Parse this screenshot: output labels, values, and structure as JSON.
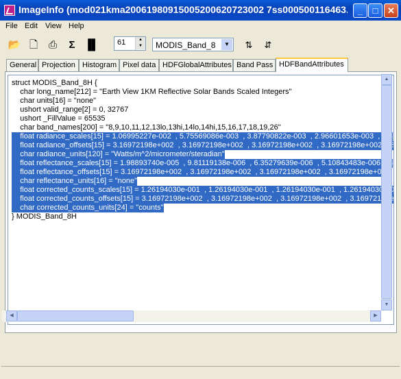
{
  "window": {
    "title": "ImageInfo (mod021kma20061980915005200620723002 7ss000500116463...",
    "buttons": {
      "minimize": "_",
      "maximize": "□",
      "close": "✕"
    }
  },
  "menu": [
    "File",
    "Edit",
    "View",
    "Help"
  ],
  "toolbar": {
    "icons": [
      "folder-open-icon",
      "new-file-icon",
      "print-icon",
      "sigma-icon",
      "histogram-icon",
      "sort-up-icon",
      "sort-down-icon"
    ],
    "band_number": "61",
    "band_select": "MODIS_Band_8"
  },
  "tabs": [
    "General",
    "Projection",
    "Histogram",
    "Pixel data",
    "HDFGlobalAttributes",
    "Band Pass",
    "HDFBandAttributes"
  ],
  "active_tab": "HDFBandAttributes",
  "content": {
    "lines": [
      "struct MODIS_Band_8H {",
      "    char long_name[212] = \"Earth View 1KM Reflective Solar Bands Scaled Integers\"",
      "    char units[16] = \"none\"",
      "    ushort valid_range[2] = 0, 32767",
      "    ushort _FillValue = 65535",
      "    char band_names[200] = \"8,9,10,11,12,13lo,13hi,14lo,14hi,15,16,17,18,19,26\"",
      "    float radiance_scales[15] = 1.06995227e-002  , 5.75569086e-003  , 3.87790822e-003  , 2.96601653e-003  , 2.5",
      "    float radiance_offsets[15] = 3.16972198e+002  , 3.16972198e+002  , 3.16972198e+002  , 3.16972198e+002  , 3",
      "    char radiance_units[120] = \"Watts/m^2/micrometer/steradian\"",
      "    float reflectance_scales[15] = 1.98893740e-005  , 9.81119138e-006  , 6.35279639e-006  , 5.10843483e-006  , 4",
      "    float reflectance_offsets[15] = 3.16972198e+002  , 3.16972198e+002  , 3.16972198e+002  , 3.16972198e+002",
      "    char reflectance_units[16] = \"none\"",
      "    float corrected_counts_scales[15] = 1.26194030e-001  , 1.26194030e-001  , 1.26194030e-001  , 1.26194030e-0",
      "    float corrected_counts_offsets[15] = 3.16972198e+002  , 3.16972198e+002  , 3.16972198e+002  , 3.16972198e",
      "    char corrected_counts_units[24] = \"counts\"",
      "} MODIS_Band_8H"
    ],
    "selected_line_indices": [
      6,
      7,
      8,
      9,
      10,
      11,
      12,
      13,
      14
    ]
  },
  "colors": {
    "selection": "#316ac5",
    "titlebar": "#0a4ac8"
  }
}
